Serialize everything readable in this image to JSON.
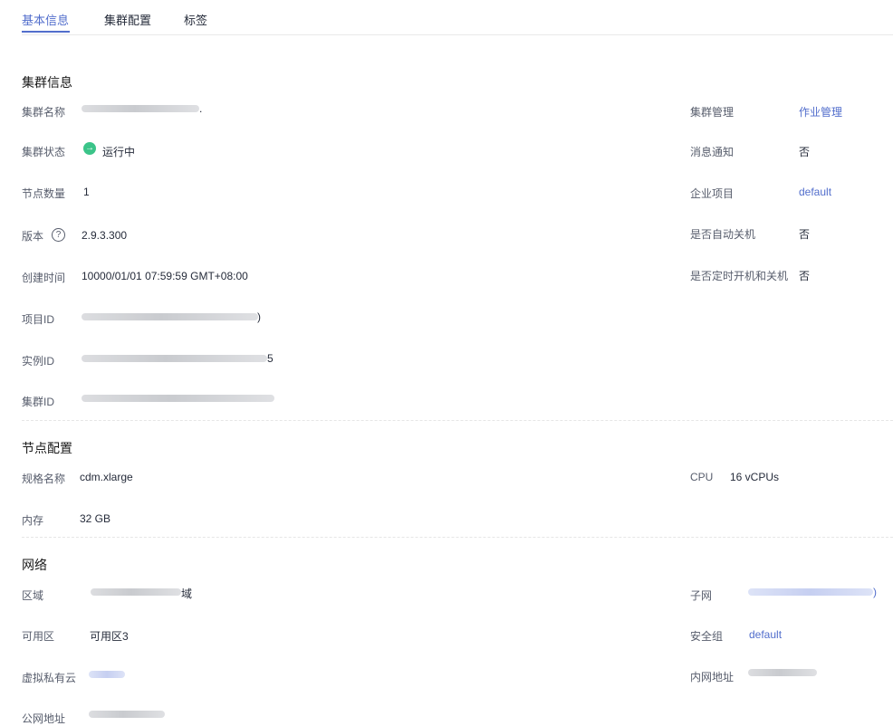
{
  "tabs": [
    {
      "label": "基本信息",
      "active": true
    },
    {
      "label": "集群配置",
      "active": false
    },
    {
      "label": "标签",
      "active": false
    }
  ],
  "cluster_info": {
    "title": "集群信息",
    "name": {
      "label": "集群名称",
      "value_tail": "."
    },
    "status": {
      "label": "集群状态",
      "value": "运行中",
      "icon": "arrow-right-circle-icon",
      "color": "#3bc489"
    },
    "nodes": {
      "label": "节点数量",
      "value": "1"
    },
    "version": {
      "label": "版本",
      "value": "2.9.3.300",
      "icon": "help-circle-icon"
    },
    "created": {
      "label": "创建时间",
      "value": "10000/01/01 07:59:59 GMT+08:00"
    },
    "project_id": {
      "label": "项目ID",
      "value_tail": ")"
    },
    "instance_id": {
      "label": "实例ID",
      "value_tail": "5"
    },
    "cluster_id": {
      "label": "集群ID"
    },
    "management": {
      "label": "集群管理",
      "value": "作业管理"
    },
    "notify": {
      "label": "消息通知",
      "value": "否"
    },
    "enterprise": {
      "label": "企业项目",
      "value": "default"
    },
    "auto_shutdown": {
      "label": "是否自动关机",
      "value": "否"
    },
    "scheduled": {
      "label": "是否定时开机和关机",
      "value": "否"
    }
  },
  "node_config": {
    "title": "节点配置",
    "flavor": {
      "label": "规格名称",
      "value": "cdm.xlarge"
    },
    "memory": {
      "label": "内存",
      "value": "32 GB"
    },
    "cpu": {
      "label": "CPU",
      "value": "16 vCPUs"
    }
  },
  "network": {
    "title": "网络",
    "region": {
      "label": "区域",
      "value_tail": "域"
    },
    "az": {
      "label": "可用区",
      "value": "可用区3"
    },
    "vpc": {
      "label": "虚拟私有云"
    },
    "public_ip": {
      "label": "公网地址"
    },
    "subnet": {
      "label": "子网",
      "value_tail": ")"
    },
    "security_group": {
      "label": "安全组",
      "value": "default"
    },
    "private_ip": {
      "label": "内网地址"
    }
  },
  "colors": {
    "accent": "#526ecc",
    "success": "#3bc489"
  }
}
